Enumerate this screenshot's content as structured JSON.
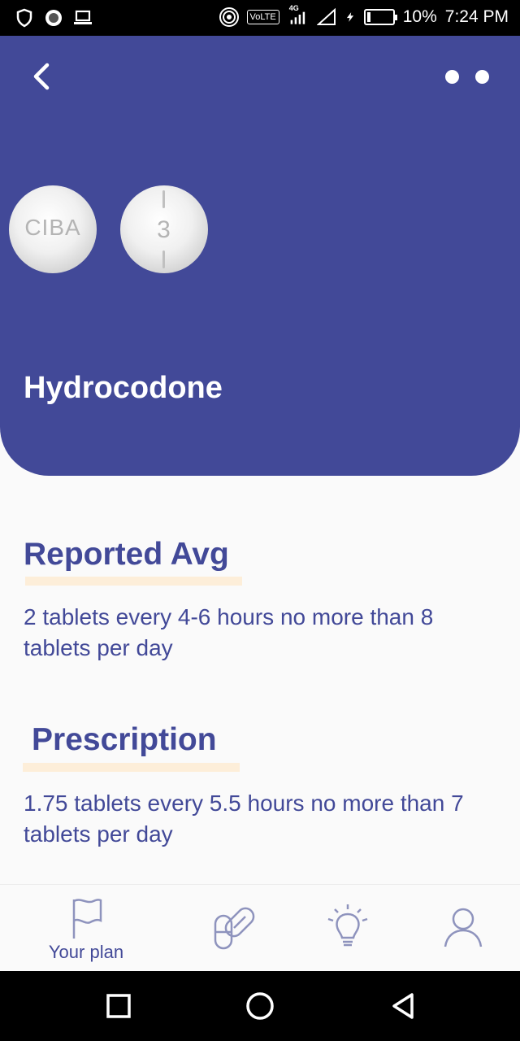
{
  "status_bar": {
    "network_badge": "VoLTE",
    "network_type": "4G",
    "battery": "10%",
    "time": "7:24 PM"
  },
  "header": {
    "drug_name": "Hydrocodone",
    "background_color": "#424998",
    "pills": [
      {
        "imprint": "CIBA"
      },
      {
        "imprint": "3"
      }
    ]
  },
  "reported_avg": {
    "title": "Reported Avg",
    "text": "2 tablets every 4-6 hours no more than 8 tablets per day"
  },
  "prescription": {
    "title": "Prescription",
    "text": "1.75 tablets every 5.5 hours no more than 7 tablets per day"
  },
  "bottom_nav": {
    "items": [
      {
        "label": "Your plan",
        "icon": "flag-icon",
        "selected": true
      },
      {
        "label": "",
        "icon": "pills-icon"
      },
      {
        "label": "",
        "icon": "lightbulb-icon"
      },
      {
        "label": "",
        "icon": "person-icon"
      }
    ]
  },
  "colors": {
    "accent": "#424998",
    "highlight": "#fdeed9"
  }
}
